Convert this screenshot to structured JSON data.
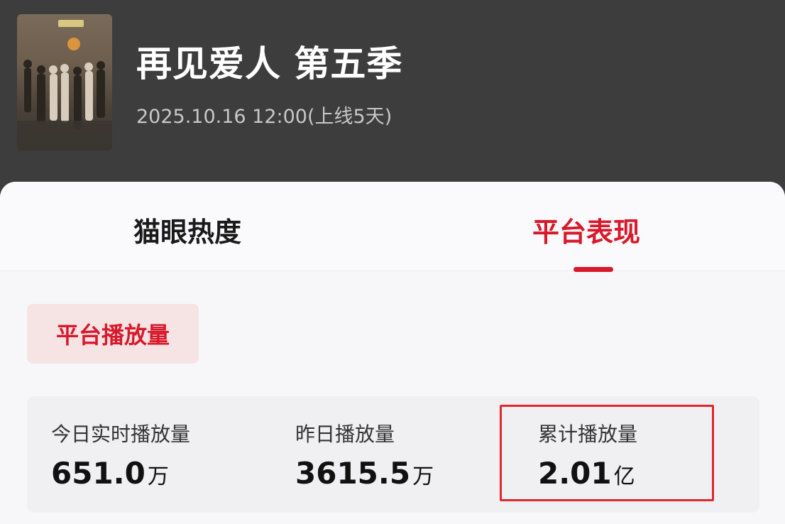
{
  "show": {
    "title": "再见爱人 第五季",
    "release": "2025.10.16 12:00(上线5天)"
  },
  "tabs": [
    {
      "label": "猫眼热度",
      "active": false
    },
    {
      "label": "平台表现",
      "active": true
    }
  ],
  "section_chip": "平台播放量",
  "stats": {
    "today": {
      "label": "今日实时播放量",
      "value": "651.0",
      "unit": "万"
    },
    "yesterday": {
      "label": "昨日播放量",
      "value": "3615.5",
      "unit": "万"
    },
    "total": {
      "label": "累计播放量",
      "value": "2.01",
      "unit": "亿",
      "highlighted": true
    }
  },
  "colors": {
    "accent": "#d8192b",
    "header_bg": "#3d3d3d",
    "chip_bg": "#f6e4e5",
    "highlight_border": "#e2262d"
  }
}
